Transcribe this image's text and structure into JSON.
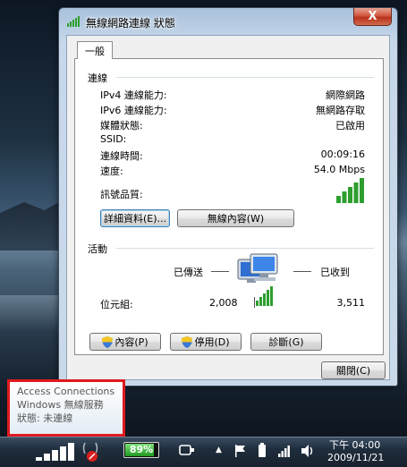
{
  "window": {
    "title": "無線網路連線 狀態",
    "close_label": "X"
  },
  "tabs": [
    {
      "label": "一般"
    }
  ],
  "connection": {
    "heading": "連線",
    "rows": [
      {
        "label": "IPv4 連線能力:",
        "value": "網際網路"
      },
      {
        "label": "IPv6 連線能力:",
        "value": "無網路存取"
      },
      {
        "label": "媒體狀態:",
        "value": "已啟用"
      },
      {
        "label": "SSID:",
        "value": ""
      },
      {
        "label": "連線時間:",
        "value": "00:09:16"
      },
      {
        "label": "速度:",
        "value": "54.0 Mbps"
      }
    ],
    "signal_label": "訊號品質:",
    "signal_bars": 5,
    "details_button": "詳細資料(E)...",
    "wireless_props_button": "無線內容(W)"
  },
  "activity": {
    "heading": "活動",
    "sent_label": "已傳送",
    "received_label": "已收到",
    "bytes_label": "位元組:",
    "bytes_sent": "2,008",
    "bytes_received": "3,511",
    "properties_button": "內容(P)",
    "disable_button": "停用(D)",
    "diagnose_button": "診斷(G)"
  },
  "close_button": "關閉(C)",
  "tooltip": {
    "line1": "Access Connections",
    "line2": "Windows 無線服務",
    "line3": "狀態: 未連線"
  },
  "taskbar": {
    "battery_percent": "89%",
    "battery_level": 0.89,
    "time": "下午 04:00",
    "date": "2009/11/21"
  },
  "colors": {
    "signal_green": "#2e9e2e",
    "tooltip_border": "#e0191e",
    "battery_green": "#3fbf3f"
  }
}
